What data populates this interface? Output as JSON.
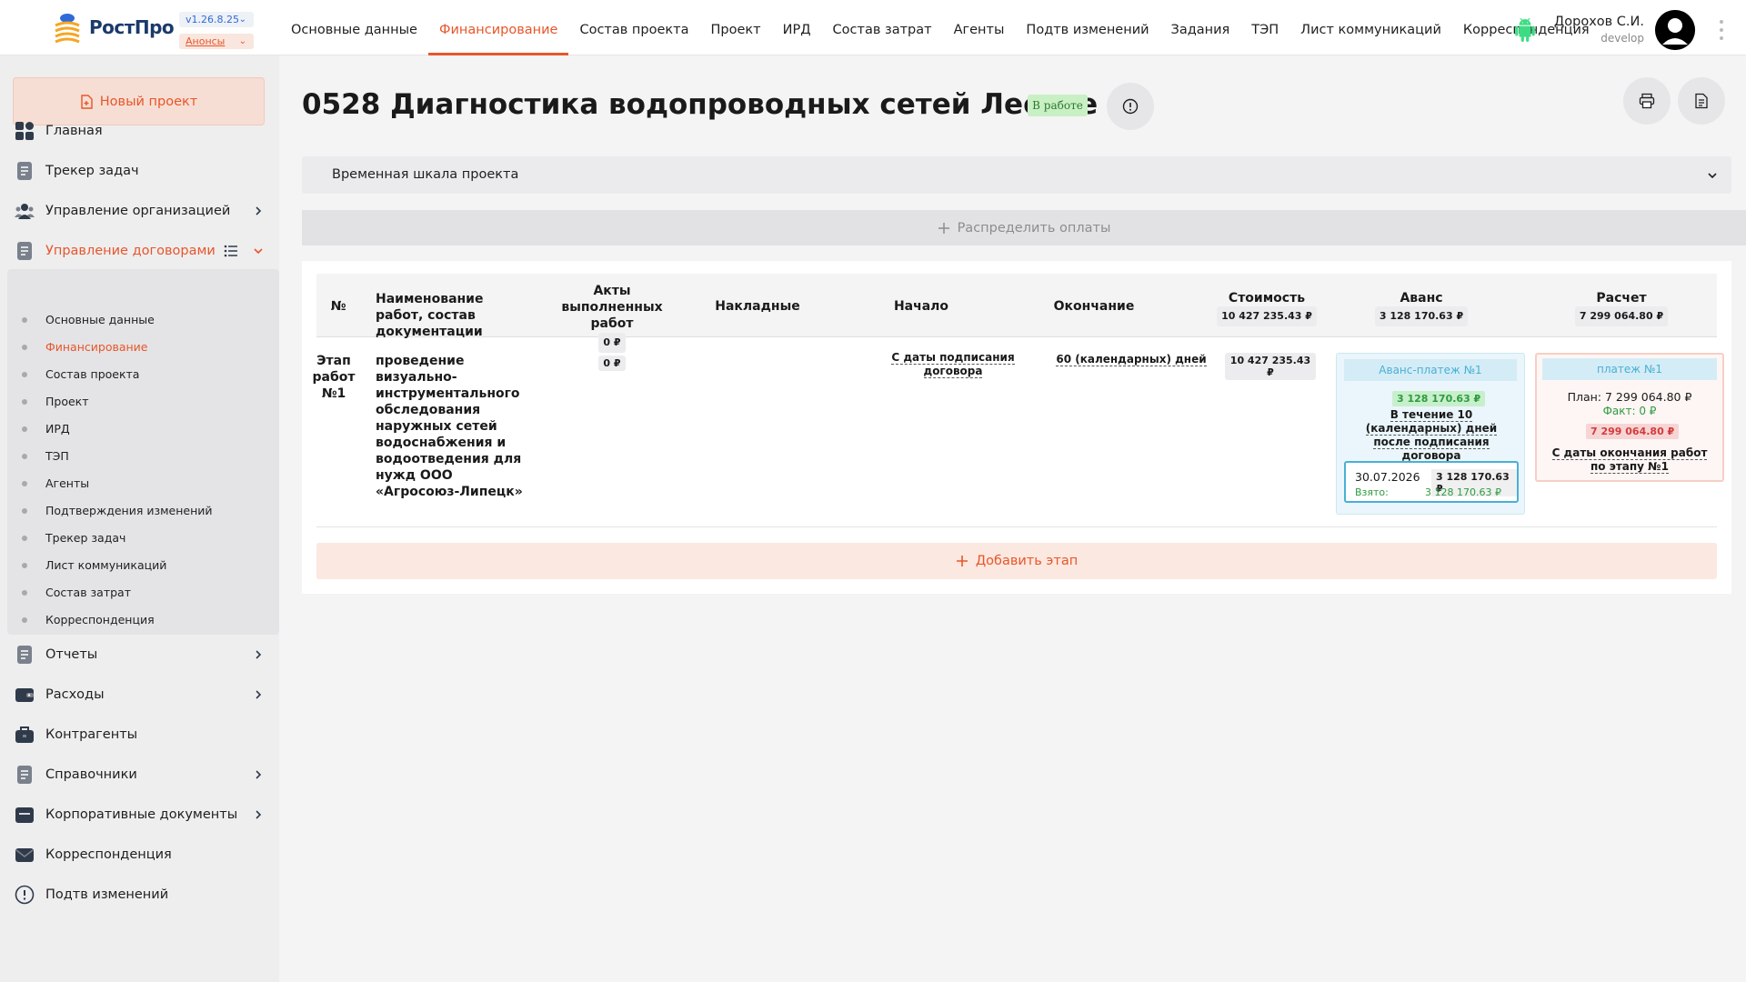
{
  "header": {
    "logo_text": "РостПро",
    "version": "v1.26.8.25",
    "announcements": "Анонсы",
    "nav": [
      {
        "label": "Основные данные"
      },
      {
        "label": "Финансирование",
        "active": true
      },
      {
        "label": "Состав проекта"
      },
      {
        "label": "Проект"
      },
      {
        "label": "ИРД"
      },
      {
        "label": "Состав затрат"
      },
      {
        "label": "Агенты"
      },
      {
        "label": "Подтв изменений"
      },
      {
        "label": "Задания"
      },
      {
        "label": "ТЭП"
      },
      {
        "label": "Лист коммуникаций"
      },
      {
        "label": "Корреспонденция"
      }
    ],
    "user": {
      "name": "Дорохов С.И.",
      "role": "develop"
    }
  },
  "sidebar": {
    "new_project": "Новый проект",
    "items": [
      {
        "label": "Главная",
        "icon": "dashboard-icon"
      },
      {
        "label": "Трекер задач",
        "icon": "document-icon"
      },
      {
        "label": "Управление организацией",
        "icon": "people-icon",
        "chevron": true
      },
      {
        "label": "Управление договорами",
        "icon": "document-icon",
        "active": true,
        "expanded": true
      }
    ],
    "contracts_sub": [
      {
        "label": "Основные данные"
      },
      {
        "label": "Финансирование",
        "active": true
      },
      {
        "label": "Состав проекта"
      },
      {
        "label": "Проект"
      },
      {
        "label": "ИРД"
      },
      {
        "label": "ТЭП"
      },
      {
        "label": "Агенты"
      },
      {
        "label": "Подтверждения изменений"
      },
      {
        "label": "Трекер задач"
      },
      {
        "label": "Лист коммуникаций"
      },
      {
        "label": "Состав затрат"
      },
      {
        "label": "Корреспонденция"
      }
    ],
    "bottom_items": [
      {
        "label": "Отчеты",
        "icon": "document-icon",
        "chevron": true
      },
      {
        "label": "Расходы",
        "icon": "wallet-icon",
        "chevron": true
      },
      {
        "label": "Контрагенты",
        "icon": "briefcase-icon"
      },
      {
        "label": "Справочники",
        "icon": "document-icon",
        "chevron": true
      },
      {
        "label": "Корпоративные документы",
        "icon": "folder-icon",
        "chevron": true
      },
      {
        "label": "Корреспонденция",
        "icon": "mail-icon"
      },
      {
        "label": "Подтв изменений",
        "icon": "alert-icon"
      }
    ]
  },
  "main": {
    "title": "0528 Диагностика водопроводных сетей Лесное",
    "status": "В работе",
    "timeline_label": "Временная шкала проекта",
    "distribute_label": "Распределить оплаты",
    "table": {
      "headers": {
        "num": "№",
        "name": "Наименование работ, состав документации",
        "acts": "Акты выполненных работ",
        "acts_total": "0 ₽",
        "invoices": "Накладные",
        "start": "Начало",
        "end": "Окончание",
        "cost": "Стоимость",
        "cost_total": "10 427 235.43 ₽",
        "advance": "Аванс",
        "advance_total": "3 128 170.63 ₽",
        "settlement": "Расчет",
        "settlement_total": "7 299 064.80 ₽"
      },
      "rows": [
        {
          "stage": "Этап работ №1",
          "name": "проведение визуально-инструментального обследования наружных сетей водоснабжения и водоотведения для нужд ООО «Агросоюз-Липецк»",
          "acts": "0 ₽",
          "start": "С даты подписания договора",
          "end": "60 (календарных) дней",
          "cost": "10 427 235.43 ₽",
          "advance": {
            "title": "Аванс-платеж №1",
            "amount": "3 128 170.63 ₽",
            "condition": "В течение 10 (календарных) дней после подписания договора",
            "payment": {
              "date": "30.07.2026",
              "amount": "3 128 170.63 ₽",
              "taken_label": "Взято:",
              "taken": "3 128 170.63 ₽"
            }
          },
          "settlement": {
            "title": "платеж №1",
            "plan": "План: 7 299 064.80 ₽",
            "fact": "Факт: 0 ₽",
            "amount": "7 299 064.80 ₽",
            "condition": "С даты окончания работ по этапу №1"
          }
        }
      ]
    },
    "add_stage_label": "Добавить этап"
  },
  "colors": {
    "accent": "#e8562a",
    "status_bg": "#c9efc5",
    "info_blue": "#4ab0d5",
    "success": "#2e9b3f",
    "danger": "#d43b3b"
  }
}
